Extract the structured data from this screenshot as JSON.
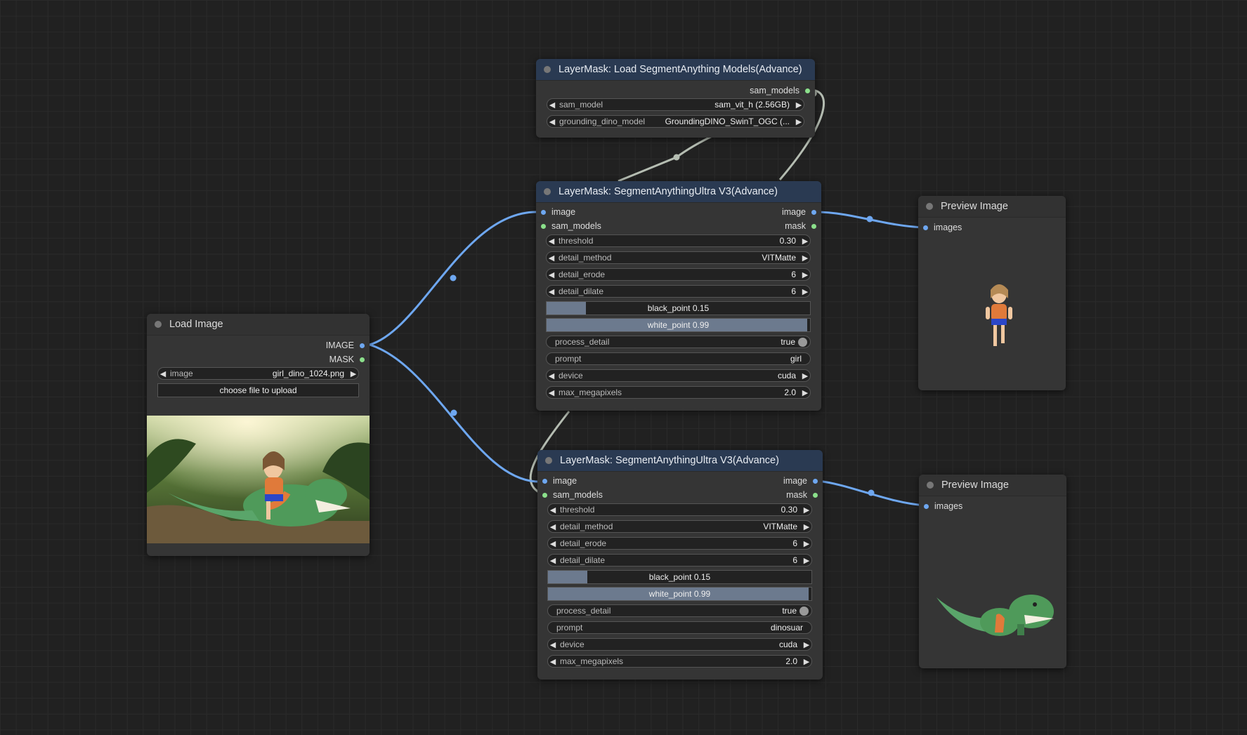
{
  "colors": {
    "image_link": "#6ea7f0",
    "model_link": "#b5bdb2",
    "mask_port": "#8be08b"
  },
  "load_image": {
    "title": "Load Image",
    "outputs": [
      "IMAGE",
      "MASK"
    ],
    "image_label": "image",
    "image_value": "girl_dino_1024.png",
    "upload_button": "choose file to upload"
  },
  "loader": {
    "title": "LayerMask: Load SegmentAnything Models(Advance)",
    "output": "sam_models",
    "sam_model_label": "sam_model",
    "sam_model_value": "sam_vit_h (2.56GB)",
    "dino_label": "grounding_dino_model",
    "dino_value": "GroundingDINO_SwinT_OGC (..."
  },
  "seg1": {
    "title": "LayerMask: SegmentAnythingUltra V3(Advance)",
    "inputs": [
      "image",
      "sam_models"
    ],
    "outputs": [
      "image",
      "mask"
    ],
    "threshold": {
      "label": "threshold",
      "value": "0.30"
    },
    "detail_method": {
      "label": "detail_method",
      "value": "VITMatte"
    },
    "detail_erode": {
      "label": "detail_erode",
      "value": "6"
    },
    "detail_dilate": {
      "label": "detail_dilate",
      "value": "6"
    },
    "black_point": {
      "text": "black_point  0.15",
      "fraction": 0.15
    },
    "white_point": {
      "text": "white_point  0.99",
      "fraction": 0.99
    },
    "process_detail": {
      "label": "process_detail",
      "value": "true"
    },
    "prompt": {
      "label": "prompt",
      "value": "girl"
    },
    "device": {
      "label": "device",
      "value": "cuda"
    },
    "max_megapixels": {
      "label": "max_megapixels",
      "value": "2.0"
    }
  },
  "seg2": {
    "title": "LayerMask: SegmentAnythingUltra V3(Advance)",
    "inputs": [
      "image",
      "sam_models"
    ],
    "outputs": [
      "image",
      "mask"
    ],
    "threshold": {
      "label": "threshold",
      "value": "0.30"
    },
    "detail_method": {
      "label": "detail_method",
      "value": "VITMatte"
    },
    "detail_erode": {
      "label": "detail_erode",
      "value": "6"
    },
    "detail_dilate": {
      "label": "detail_dilate",
      "value": "6"
    },
    "black_point": {
      "text": "black_point  0.15",
      "fraction": 0.15
    },
    "white_point": {
      "text": "white_point  0.99",
      "fraction": 0.99
    },
    "process_detail": {
      "label": "process_detail",
      "value": "true"
    },
    "prompt": {
      "label": "prompt",
      "value": "dinosuar"
    },
    "device": {
      "label": "device",
      "value": "cuda"
    },
    "max_megapixels": {
      "label": "max_megapixels",
      "value": "2.0"
    }
  },
  "preview1": {
    "title": "Preview Image",
    "input": "images"
  },
  "preview2": {
    "title": "Preview Image",
    "input": "images"
  }
}
